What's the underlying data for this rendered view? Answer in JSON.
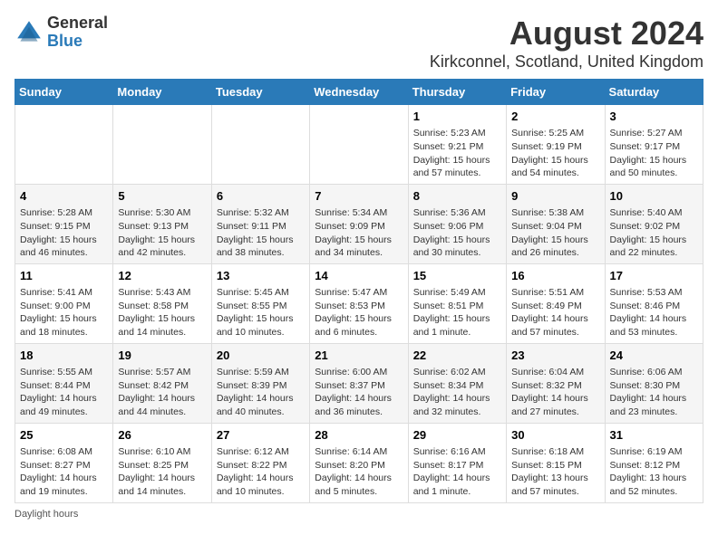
{
  "logo": {
    "general": "General",
    "blue": "Blue"
  },
  "title": "August 2024",
  "subtitle": "Kirkconnel, Scotland, United Kingdom",
  "days_of_week": [
    "Sunday",
    "Monday",
    "Tuesday",
    "Wednesday",
    "Thursday",
    "Friday",
    "Saturday"
  ],
  "footer_label": "Daylight hours",
  "weeks": [
    [
      {
        "day": "",
        "info": ""
      },
      {
        "day": "",
        "info": ""
      },
      {
        "day": "",
        "info": ""
      },
      {
        "day": "",
        "info": ""
      },
      {
        "day": "1",
        "info": "Sunrise: 5:23 AM\nSunset: 9:21 PM\nDaylight: 15 hours and 57 minutes."
      },
      {
        "day": "2",
        "info": "Sunrise: 5:25 AM\nSunset: 9:19 PM\nDaylight: 15 hours and 54 minutes."
      },
      {
        "day": "3",
        "info": "Sunrise: 5:27 AM\nSunset: 9:17 PM\nDaylight: 15 hours and 50 minutes."
      }
    ],
    [
      {
        "day": "4",
        "info": "Sunrise: 5:28 AM\nSunset: 9:15 PM\nDaylight: 15 hours and 46 minutes."
      },
      {
        "day": "5",
        "info": "Sunrise: 5:30 AM\nSunset: 9:13 PM\nDaylight: 15 hours and 42 minutes."
      },
      {
        "day": "6",
        "info": "Sunrise: 5:32 AM\nSunset: 9:11 PM\nDaylight: 15 hours and 38 minutes."
      },
      {
        "day": "7",
        "info": "Sunrise: 5:34 AM\nSunset: 9:09 PM\nDaylight: 15 hours and 34 minutes."
      },
      {
        "day": "8",
        "info": "Sunrise: 5:36 AM\nSunset: 9:06 PM\nDaylight: 15 hours and 30 minutes."
      },
      {
        "day": "9",
        "info": "Sunrise: 5:38 AM\nSunset: 9:04 PM\nDaylight: 15 hours and 26 minutes."
      },
      {
        "day": "10",
        "info": "Sunrise: 5:40 AM\nSunset: 9:02 PM\nDaylight: 15 hours and 22 minutes."
      }
    ],
    [
      {
        "day": "11",
        "info": "Sunrise: 5:41 AM\nSunset: 9:00 PM\nDaylight: 15 hours and 18 minutes."
      },
      {
        "day": "12",
        "info": "Sunrise: 5:43 AM\nSunset: 8:58 PM\nDaylight: 15 hours and 14 minutes."
      },
      {
        "day": "13",
        "info": "Sunrise: 5:45 AM\nSunset: 8:55 PM\nDaylight: 15 hours and 10 minutes."
      },
      {
        "day": "14",
        "info": "Sunrise: 5:47 AM\nSunset: 8:53 PM\nDaylight: 15 hours and 6 minutes."
      },
      {
        "day": "15",
        "info": "Sunrise: 5:49 AM\nSunset: 8:51 PM\nDaylight: 15 hours and 1 minute."
      },
      {
        "day": "16",
        "info": "Sunrise: 5:51 AM\nSunset: 8:49 PM\nDaylight: 14 hours and 57 minutes."
      },
      {
        "day": "17",
        "info": "Sunrise: 5:53 AM\nSunset: 8:46 PM\nDaylight: 14 hours and 53 minutes."
      }
    ],
    [
      {
        "day": "18",
        "info": "Sunrise: 5:55 AM\nSunset: 8:44 PM\nDaylight: 14 hours and 49 minutes."
      },
      {
        "day": "19",
        "info": "Sunrise: 5:57 AM\nSunset: 8:42 PM\nDaylight: 14 hours and 44 minutes."
      },
      {
        "day": "20",
        "info": "Sunrise: 5:59 AM\nSunset: 8:39 PM\nDaylight: 14 hours and 40 minutes."
      },
      {
        "day": "21",
        "info": "Sunrise: 6:00 AM\nSunset: 8:37 PM\nDaylight: 14 hours and 36 minutes."
      },
      {
        "day": "22",
        "info": "Sunrise: 6:02 AM\nSunset: 8:34 PM\nDaylight: 14 hours and 32 minutes."
      },
      {
        "day": "23",
        "info": "Sunrise: 6:04 AM\nSunset: 8:32 PM\nDaylight: 14 hours and 27 minutes."
      },
      {
        "day": "24",
        "info": "Sunrise: 6:06 AM\nSunset: 8:30 PM\nDaylight: 14 hours and 23 minutes."
      }
    ],
    [
      {
        "day": "25",
        "info": "Sunrise: 6:08 AM\nSunset: 8:27 PM\nDaylight: 14 hours and 19 minutes."
      },
      {
        "day": "26",
        "info": "Sunrise: 6:10 AM\nSunset: 8:25 PM\nDaylight: 14 hours and 14 minutes."
      },
      {
        "day": "27",
        "info": "Sunrise: 6:12 AM\nSunset: 8:22 PM\nDaylight: 14 hours and 10 minutes."
      },
      {
        "day": "28",
        "info": "Sunrise: 6:14 AM\nSunset: 8:20 PM\nDaylight: 14 hours and 5 minutes."
      },
      {
        "day": "29",
        "info": "Sunrise: 6:16 AM\nSunset: 8:17 PM\nDaylight: 14 hours and 1 minute."
      },
      {
        "day": "30",
        "info": "Sunrise: 6:18 AM\nSunset: 8:15 PM\nDaylight: 13 hours and 57 minutes."
      },
      {
        "day": "31",
        "info": "Sunrise: 6:19 AM\nSunset: 8:12 PM\nDaylight: 13 hours and 52 minutes."
      }
    ]
  ]
}
